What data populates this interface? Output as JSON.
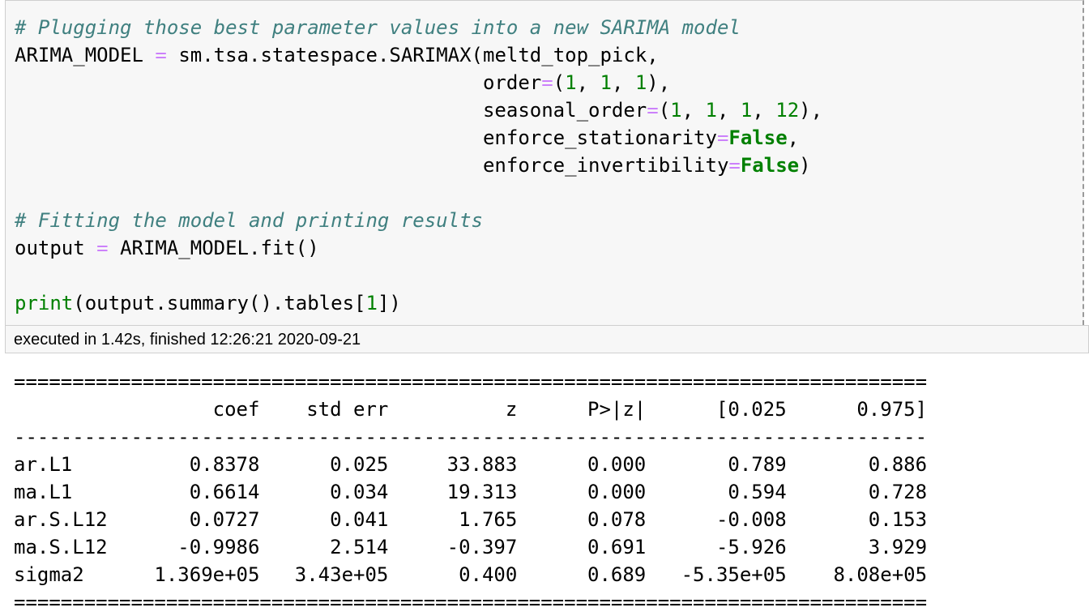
{
  "code": {
    "comment1": "# Plugging those best parameter values into a new SARIMA model",
    "line2_var": "ARIMA_MODEL",
    "line2_call": "sm.tsa.statespace.SARIMAX(meltd_top_pick,",
    "order_kw": "order",
    "order_val": [
      "1",
      "1",
      "1"
    ],
    "seasonal_kw": "seasonal_order",
    "seasonal_val": [
      "1",
      "1",
      "1",
      "12"
    ],
    "stationarity_kw": "enforce_stationarity",
    "invertibility_kw": "enforce_invertibility",
    "false_kw": "False",
    "comment2": "# Fitting the model and printing results",
    "output_var": "output",
    "fit_call": "ARIMA_MODEL.fit()",
    "print_fn": "print",
    "print_arg": "(output.summary().tables[",
    "print_index": "1",
    "print_close": "])"
  },
  "execution_status": "executed in 1.42s, finished 12:26:21 2020-09-21",
  "results_table": {
    "rule_double": "==============================================================================",
    "rule_single": "------------------------------------------------------------------------------",
    "header": "                 coef    std err          z      P>|z|      [0.025      0.975]",
    "rows": [
      "ar.L1          0.8378      0.025     33.883      0.000       0.789       0.886",
      "ma.L1          0.6614      0.034     19.313      0.000       0.594       0.728",
      "ar.S.L12       0.0727      0.041      1.765      0.078      -0.008       0.153",
      "ma.S.L12      -0.9986      2.514     -0.397      0.691      -5.926       3.929",
      "sigma2      1.369e+05   3.43e+05      0.400      0.689   -5.35e+05    8.08e+05"
    ]
  }
}
